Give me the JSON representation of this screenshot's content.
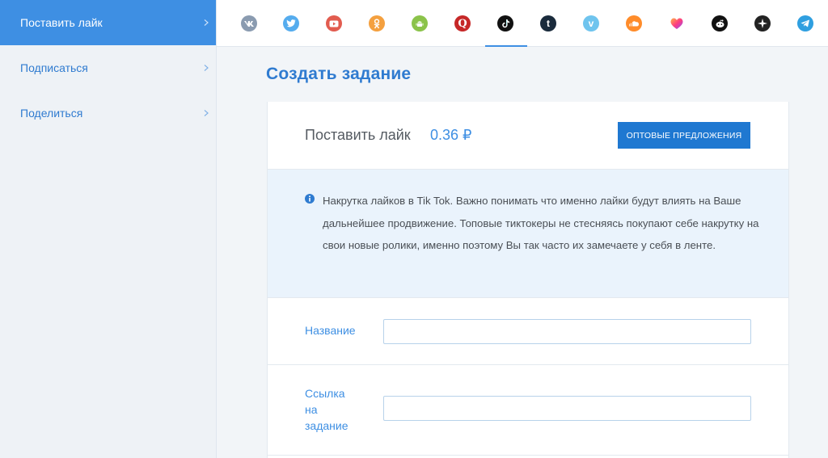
{
  "sidebar": {
    "items": [
      {
        "label": "Поставить лайк",
        "active": true
      },
      {
        "label": "Подписаться",
        "active": false
      },
      {
        "label": "Поделиться",
        "active": false
      }
    ]
  },
  "topbar": {
    "icons": [
      {
        "name": "vk-icon",
        "color": "#8a9bb0"
      },
      {
        "name": "twitter-icon",
        "color": "#55acee"
      },
      {
        "name": "youtube-icon",
        "color": "#e25c4f"
      },
      {
        "name": "odnoklassniki-icon",
        "color": "#f4a03f"
      },
      {
        "name": "android-icon",
        "color": "#8bc34a"
      },
      {
        "name": "quora-icon",
        "color": "#c62828"
      },
      {
        "name": "tiktok-icon",
        "color": "#111111",
        "active": true
      },
      {
        "name": "tumblr-icon",
        "color": "#1a2b3c"
      },
      {
        "name": "vimeo-icon",
        "color": "#6fc4ee"
      },
      {
        "name": "soundcloud-icon",
        "color": "#ff8c2a"
      },
      {
        "name": "likee-icon",
        "color": "#ff4f8b"
      },
      {
        "name": "reddit-icon",
        "color": "#111111"
      },
      {
        "name": "compass-icon",
        "color": "#222222"
      },
      {
        "name": "telegram-icon",
        "color": "#2f9fe0"
      }
    ]
  },
  "main": {
    "title": "Создать задание",
    "card": {
      "task_name": "Поставить лайк",
      "price": "0.36 ₽",
      "wholesale_button": "ОПТОВЫЕ ПРЕДЛОЖЕНИЯ",
      "info_text": "Накрутка лайков в Tik Tok. Важно понимать что именно лайки будут влиять на Ваше дальнейшее продвижение. Топовые тиктокеры не стесняясь покупают себе накрутку на свои новые ролики, именно поэтому Вы так часто их замечаете у себя в ленте.",
      "fields": [
        {
          "label": "Название",
          "value": "",
          "placeholder": ""
        },
        {
          "label_lines": [
            "Ссылка",
            "на",
            "задание"
          ],
          "value": "",
          "placeholder": ""
        }
      ]
    }
  },
  "colors": {
    "accent": "#3e8fe3",
    "button": "#1f78d1",
    "info_bg": "#eaf3fc"
  }
}
